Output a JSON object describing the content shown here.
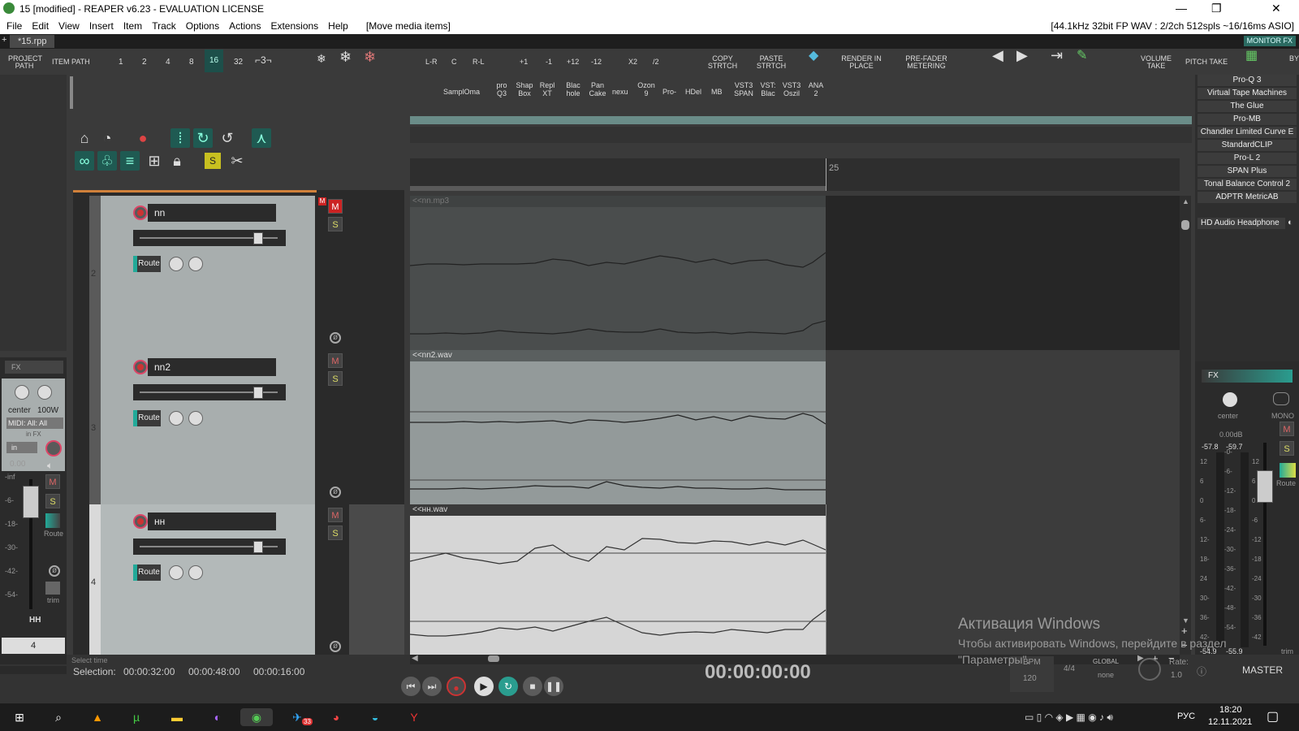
{
  "titlebar": {
    "title": "15 [modified] - REAPER v6.23 - EVALUATION LICENSE",
    "minimize": "—",
    "maximize": "❐",
    "close": "✕"
  },
  "menu": {
    "items": [
      "File",
      "Edit",
      "View",
      "Insert",
      "Item",
      "Track",
      "Options",
      "Actions",
      "Extensions",
      "Help",
      "[Move media items]"
    ],
    "status": "[44.1kHz 32bit FP WAV : 2/2ch 512spls ~16/16ms ASIO]"
  },
  "tabs": {
    "active": "*15.rpp",
    "plus": "+",
    "monitor_fx": "MONITOR FX"
  },
  "toolbar": {
    "project_path": "PROJECT PATH",
    "item_path": "ITEM PATH",
    "grid": [
      "1",
      "2",
      "4",
      "8",
      "16",
      "32"
    ],
    "pan": [
      "L-R",
      "C",
      "R-L"
    ],
    "pitch": [
      "+1",
      "-1",
      "+12",
      "-12"
    ],
    "rate": [
      "X2",
      "/2"
    ],
    "copy": "COPY STRTCH",
    "paste": "PASTE STRTCH",
    "render": "RENDER IN PLACE",
    "prefader": "PRE-FADER METERING",
    "volume_take": "VOLUME TAKE",
    "pitch_take": "PITCH TAKE",
    "by": "BY"
  },
  "plugins": [
    "SamplOma",
    "pro Q3",
    "Shap Box",
    "Repl XT",
    "Blac hole",
    "Pan Cake",
    "nexu",
    "Ozon 9",
    "Pro-",
    "HDel",
    "MB",
    "VST3 SPAN",
    "VST: Blac",
    "VST3 Oszil",
    "ANA 2"
  ],
  "fx_list": [
    "Pro-Q 3",
    "Virtual Tape Machines",
    "The Glue",
    "Pro-MB",
    "Chandler Limited Curve E",
    "StandardCLIP",
    "Pro-L 2",
    "SPAN Plus",
    "Tonal Balance Control 2",
    "ADPTR MetricAB"
  ],
  "hd_audio": "HD Audio Headphone",
  "ruler": {
    "marker": "25"
  },
  "tracks": [
    {
      "num": "2",
      "name": "nn",
      "item": "<<nn.mp3",
      "route": "Route",
      "m": "M",
      "s": "S"
    },
    {
      "num": "3",
      "name": "nn2",
      "item": "<<nn2.wav",
      "route": "Route",
      "m": "M",
      "s": "S"
    },
    {
      "num": "4",
      "name": "нн",
      "item": "<<нн.wav",
      "route": "Route",
      "m": "M",
      "s": "S"
    }
  ],
  "left_mcp": {
    "fx": "FX",
    "center": "center",
    "width": "100W",
    "midi": "MIDI: All: All",
    "in_fx": "in FX",
    "in": "in",
    "vol": "0.00",
    "inf": "-inf",
    "scale": [
      "-6-",
      "-18-",
      "-30-",
      "-42-",
      "-54-"
    ],
    "route": "Route",
    "trim": "trim",
    "name": "HH",
    "num": "4",
    "m": "M",
    "s": "S"
  },
  "master": {
    "fx": "FX",
    "center": "center",
    "mono": "MONO",
    "db": "0.00dB",
    "peakL": "-57.8",
    "peakR": "-59.7",
    "scaleL": [
      "12",
      "6",
      "0",
      "6-",
      "12-",
      "18-",
      "24",
      "30-",
      "36-",
      "42-"
    ],
    "scaleR": [
      "-0-",
      "-6-",
      "-12-",
      "-18-",
      "-24-",
      "-30-",
      "-36-",
      "-42-",
      "-48-",
      "-54-"
    ],
    "scaleR2": [
      "12",
      "6",
      "0",
      "-6",
      "-12",
      "-18",
      "-24",
      "-30",
      "-36",
      "-42"
    ],
    "bottomL": "-54.9",
    "bottomR": "-55.9",
    "route": "Route",
    "trim": "trim",
    "name": "MASTER",
    "m": "M",
    "s": "S"
  },
  "status": {
    "select_time": "Select time",
    "selection_label": "Selection:",
    "sel_start": "00:00:32:00",
    "sel_end": "00:00:48:00",
    "sel_len": "00:00:16:00",
    "time": "00:00:00:00",
    "bpm_label": "BPM",
    "bpm": "120",
    "sig": "4/4",
    "global": "GLOBAL",
    "none": "none",
    "rate_label": "Rate:",
    "rate": "1.0"
  },
  "watermark": {
    "line1": "Активация Windows",
    "line2": "Чтобы активировать Windows, перейдите в раздел",
    "line3": "\"Параметры\"."
  },
  "taskbar": {
    "lang": "РУС",
    "time": "18:20",
    "date": "12.11.2021",
    "badge": "33"
  },
  "colors": {
    "accent": "#2a9d8f",
    "record": "#cc3333",
    "mute_on": "#cc2222"
  }
}
